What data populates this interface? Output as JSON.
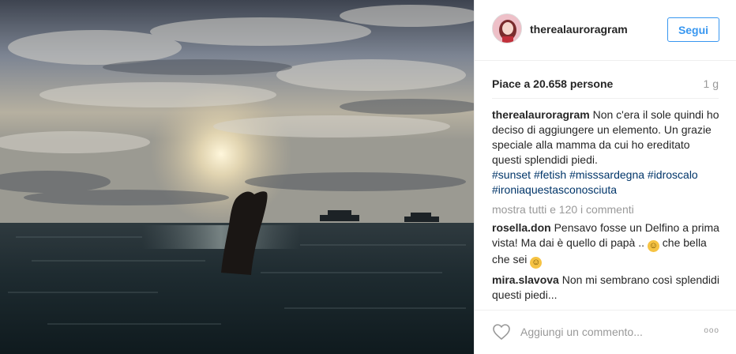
{
  "header": {
    "username": "therealauroragram",
    "follow_label": "Segui"
  },
  "stats": {
    "likes": "Piace a 20.658 persone",
    "time": "1 g"
  },
  "caption": {
    "user": "therealauroragram",
    "text": "Non c'era il sole quindi ho deciso di aggiungere un elemento. Un grazie speciale alla mamma da cui ho ereditato questi splendidi piedi.",
    "hashtags": [
      "#sunset",
      "#fetish",
      "#misssardegna",
      "#idroscalo",
      "#ironiaquestasconosciuta"
    ]
  },
  "show_all": "mostra tutti e 120 i commenti",
  "comments": [
    {
      "user": "rosella.don",
      "text_part1": "Pensavo fosse un Delfino a prima vista! Ma dai è quello di papà ..",
      "text_part2": "che bella che sei"
    },
    {
      "user": "mira.slavova",
      "text": "Non mi sembrano così splendidi questi piedi..."
    }
  ],
  "footer": {
    "comment_placeholder": "Aggiungi un commento...",
    "more_label": "ooo"
  },
  "icons": {
    "heart": "heart-icon",
    "more": "more-options-icon",
    "emoji_laugh": "laughing-emoji",
    "emoji_smile": "smiling-emoji"
  },
  "colors": {
    "follow": "#3897f0",
    "hashtag": "#003569",
    "muted": "#999999"
  }
}
